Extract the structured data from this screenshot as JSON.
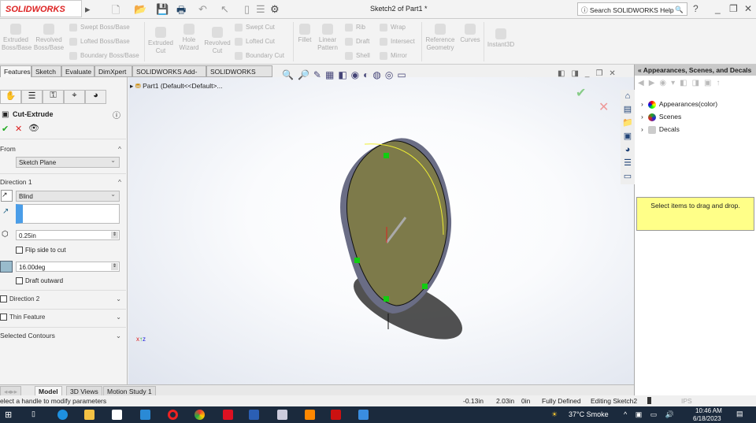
{
  "titlebar": {
    "logo": "SOLIDWORKS",
    "title": "Sketch2 of Part1 *",
    "search_placeholder": "Search SOLIDWORKS Help"
  },
  "command_manager": {
    "large": [
      {
        "label": "Extruded Boss/Base"
      },
      {
        "label": "Revolved Boss/Base"
      },
      {
        "label": "Extruded Cut"
      },
      {
        "label": "Hole Wizard"
      },
      {
        "label": "Revolved Cut"
      },
      {
        "label": "Fillet"
      },
      {
        "label": "Linear Pattern"
      },
      {
        "label": "Reference Geometry"
      },
      {
        "label": "Curves"
      },
      {
        "label": "Instant3D"
      }
    ],
    "small": [
      "Swept Boss/Base",
      "Lofted Boss/Base",
      "Boundary Boss/Base",
      "Swept Cut",
      "Lofted Cut",
      "Boundary Cut",
      "Rib",
      "Draft",
      "Shell",
      "Wrap",
      "Intersect",
      "Mirror"
    ]
  },
  "tabs": [
    "Features",
    "Sketch",
    "Evaluate",
    "DimXpert",
    "SOLIDWORKS Add-Ins",
    "SOLIDWORKS MBD"
  ],
  "feature_tree": {
    "root": "Part1  (Default<<Default>..."
  },
  "property_manager": {
    "title": "Cut-Extrude",
    "from_label": "From",
    "from_value": "Sketch Plane",
    "direction1_label": "Direction 1",
    "end_condition": "Blind",
    "depth": "0.25in",
    "flip_label": "Flip side to cut",
    "draft_angle": "16.00deg",
    "draft_outward_label": "Draft outward",
    "direction2_label": "Direction 2",
    "thin_label": "Thin Feature",
    "contours_label": "Selected Contours"
  },
  "right_panel": {
    "title": "Appearances, Scenes, and Decals",
    "items": [
      "Appearances(color)",
      "Scenes",
      "Decals"
    ],
    "hint": "Select items to drag and drop."
  },
  "bottom_tabs": [
    "Model",
    "3D Views",
    "Motion Study 1"
  ],
  "status": {
    "message": "elect a handle to modify parameters",
    "x": "-0.13in",
    "y": "2.03in",
    "z": "0in",
    "state": "Fully Defined",
    "editing": "Editing Sketch2",
    "units": "IPS"
  },
  "taskbar": {
    "weather": "37°C  Smoke",
    "time": "10:46 AM",
    "date": "6/18/2023"
  },
  "colors": {
    "accent": "#d22",
    "face": "#7d7a4a",
    "hint_bg": "#ffff88",
    "taskbar": "#1b2a3d"
  }
}
